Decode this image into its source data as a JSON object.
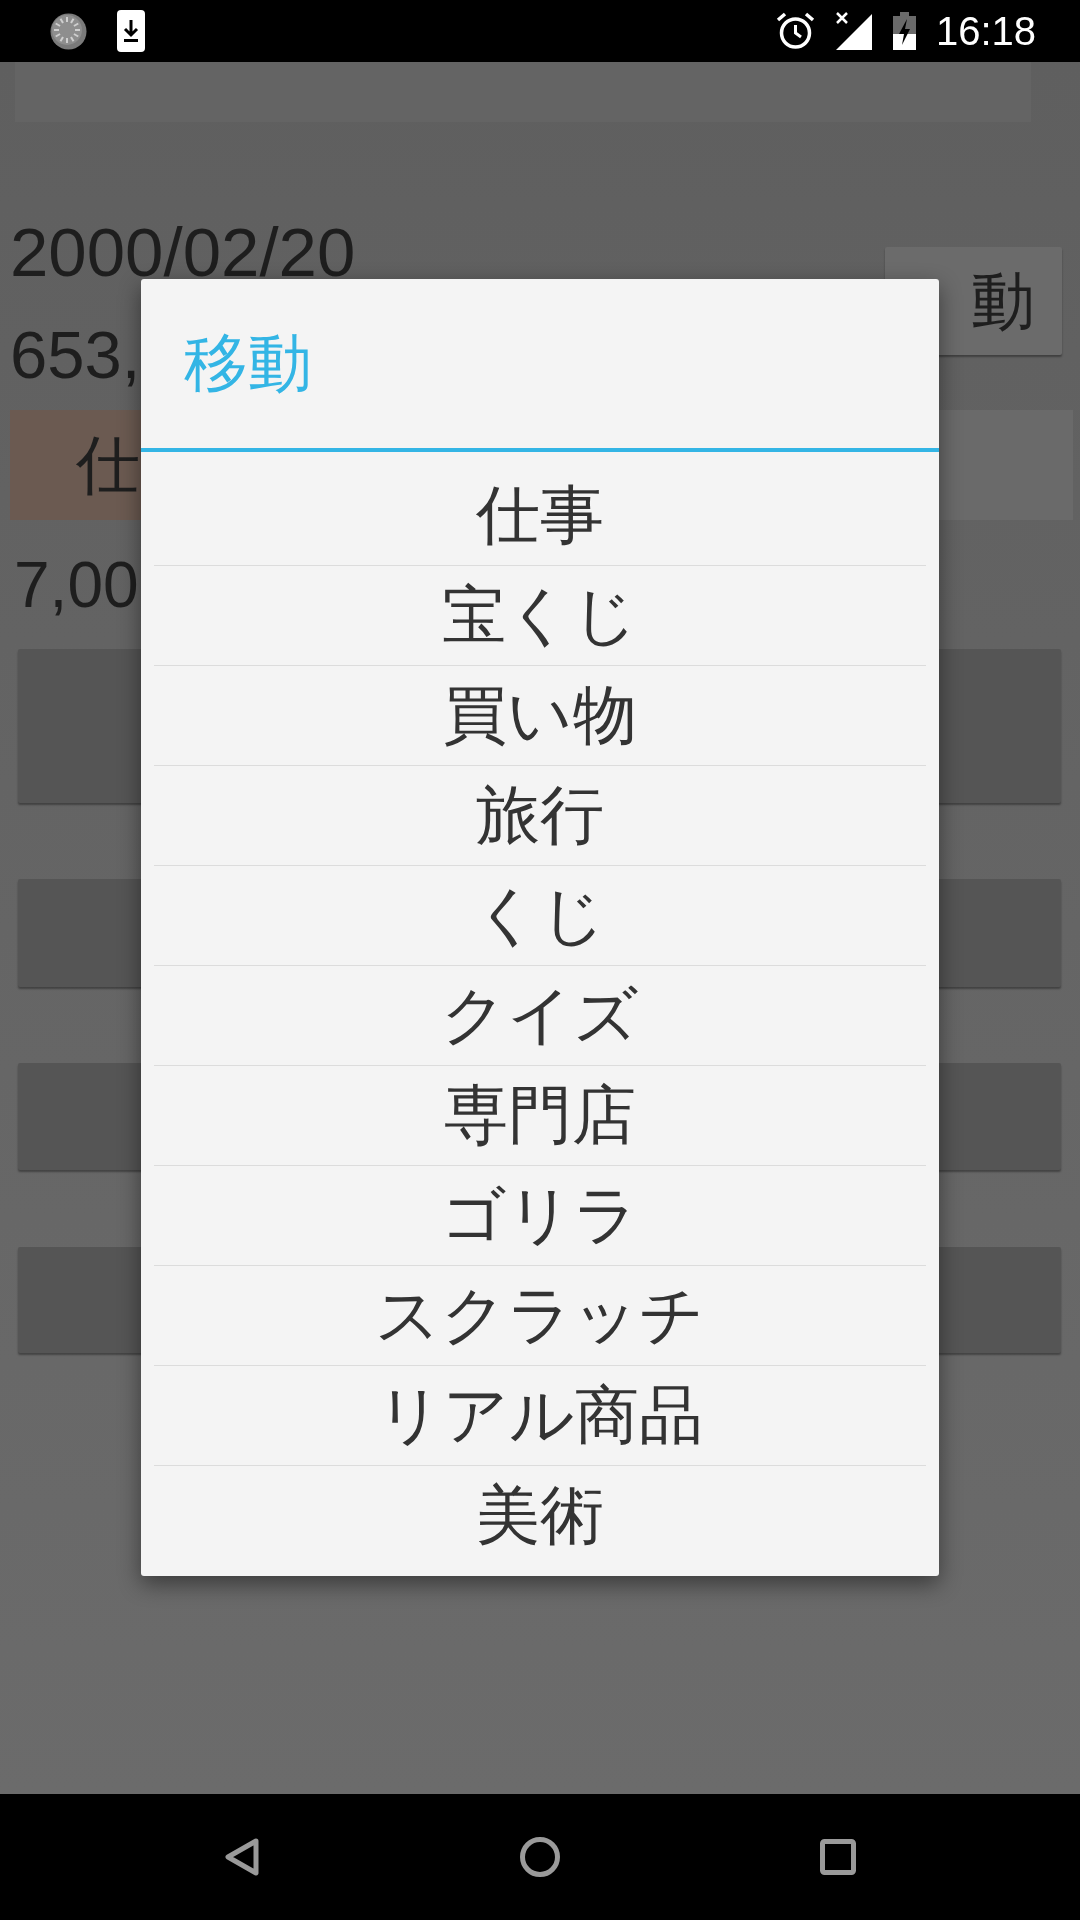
{
  "status_bar": {
    "time": "16:18"
  },
  "background_screen": {
    "date": "2000/02/20",
    "move_button": "動",
    "amount": "653,",
    "category_button": "仕",
    "value": "7,00"
  },
  "dialog": {
    "title": "移動",
    "options": [
      "仕事",
      "宝くじ",
      "買い物",
      "旅行",
      "くじ",
      "クイズ",
      "専門店",
      "ゴリラ",
      "スクラッチ",
      "リアル商品",
      "美術"
    ]
  }
}
